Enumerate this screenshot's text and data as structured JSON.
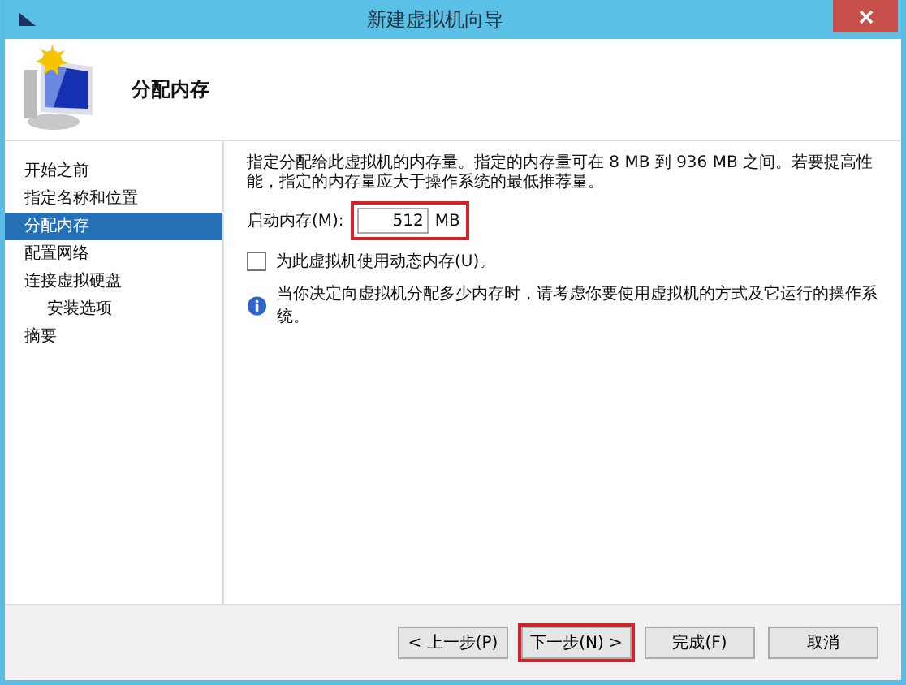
{
  "window": {
    "title": "新建虚拟机向导"
  },
  "header": {
    "title": "分配内存"
  },
  "steps": [
    {
      "label": "开始之前",
      "selected": false
    },
    {
      "label": "指定名称和位置",
      "selected": false
    },
    {
      "label": "分配内存",
      "selected": true
    },
    {
      "label": "配置网络",
      "selected": false
    },
    {
      "label": "连接虚拟硬盘",
      "selected": false,
      "children": [
        {
          "label": "安装选项",
          "selected": false
        }
      ]
    },
    {
      "label": "摘要",
      "selected": false
    }
  ],
  "description": "指定分配给此虚拟机的内存量。指定的内存量可在 8 MB 到 936 MB 之间。若要提高性能，指定的内存量应大于操作系统的最低推荐量。",
  "memory": {
    "label": "启动内存(M):",
    "value": "512",
    "unit": "MB",
    "highlighted": true
  },
  "dynamic_memory": {
    "label": "为此虚拟机使用动态内存(U)。",
    "checked": false
  },
  "info": "当你决定向虚拟机分配多少内存时，请考虑你要使用虚拟机的方式及它运行的操作系统。",
  "buttons": [
    {
      "label": "< 上一步(P)",
      "highlighted": false
    },
    {
      "label": "下一步(N) >",
      "highlighted": true
    },
    {
      "label": "完成(F)",
      "highlighted": false
    },
    {
      "label": "取消",
      "highlighted": false
    }
  ]
}
